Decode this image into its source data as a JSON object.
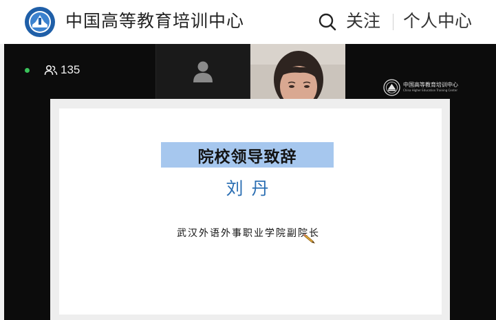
{
  "header": {
    "site_title": "中国高等教育培训中心",
    "follow_label": "关注",
    "personal_center_label": "个人中心"
  },
  "meeting": {
    "participant_count": "135",
    "watermark": {
      "cn": "中国高等教育培训中心",
      "en": "China Higher Education Training Center"
    }
  },
  "slide": {
    "banner_title": "院校领导致辞",
    "speaker_name": "刘丹",
    "speaker_title": "武汉外语外事职业学院副院长"
  },
  "colors": {
    "banner_bg": "#a6c7ee",
    "name_color": "#2c6fb3",
    "online_dot": "#39c25a"
  },
  "icons": [
    "logo",
    "search-icon",
    "people-icon",
    "avatar-icon",
    "pencil-icon"
  ]
}
